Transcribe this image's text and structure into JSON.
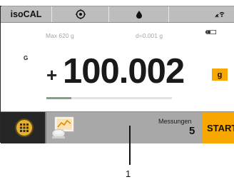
{
  "status_bar": {
    "app_label": "isoCAL",
    "level_icon": "level-target-icon",
    "drop_icon": "drop-icon",
    "wireless_icon": "wireless-icon"
  },
  "display": {
    "max_label": "Max 620 g",
    "readability_label": "d=0.001 g",
    "battery_icon": "battery-icon",
    "gross_indicator": "G",
    "sign": "+",
    "weight_value": "100.002",
    "unit": "g",
    "capacity_fraction": 0.2
  },
  "bottom_bar": {
    "menu_icon": "menu-grid-icon",
    "app_icon": "weighing-application-icon",
    "measurements_label": "Messungen",
    "measurements_count": "5",
    "start_label": "START"
  },
  "callout": {
    "number": "1"
  },
  "colors": {
    "accent": "#f6a800",
    "status_bar": "#bdbdbd",
    "bottom_bar": "#a8a8a8",
    "menu_button": "#262626",
    "progress": "#8a9c8a"
  }
}
